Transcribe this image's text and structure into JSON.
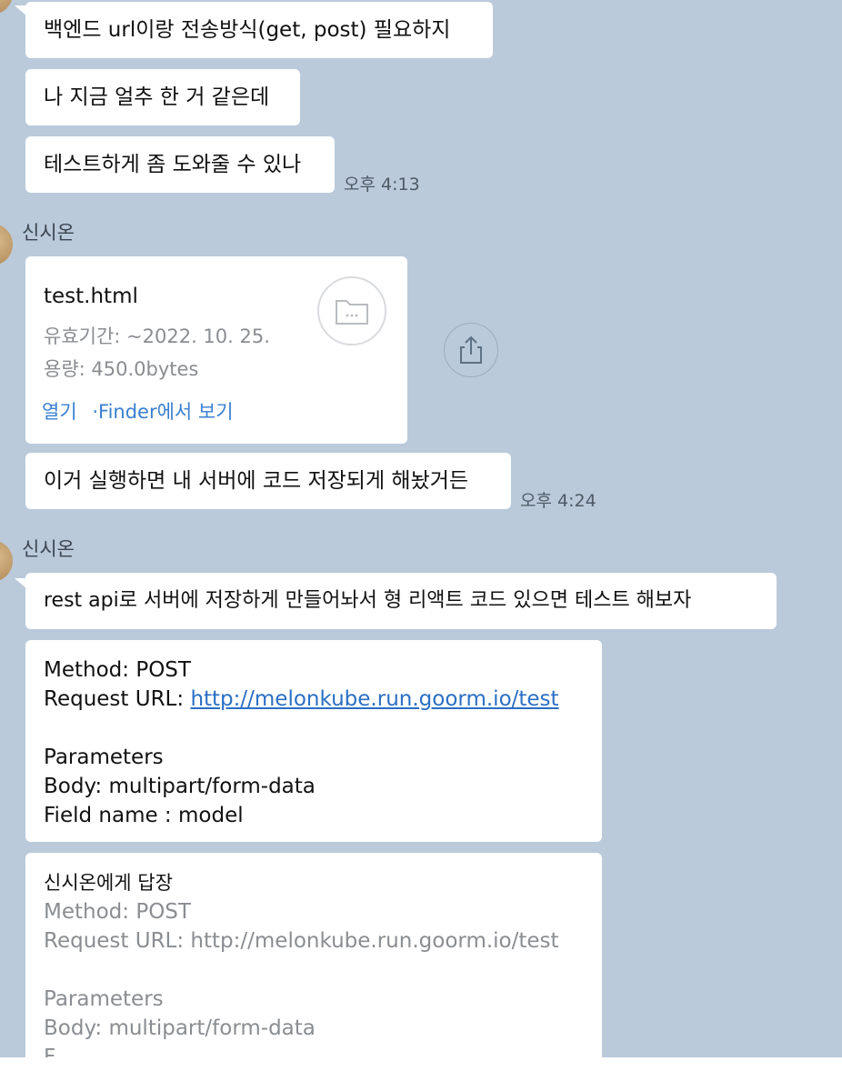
{
  "messages": {
    "m1": "백엔드 url이랑 전송방식(get, post) 필요하지",
    "m2": "나 지금 얼추 한 거 같은데",
    "m3": "테스트하게 좀 도와줄 수 있나",
    "m3_time": "오후 4:13",
    "sender1": "신시온",
    "file": {
      "name": "test.html",
      "expiry": "유효기간: ~2022. 10. 25.",
      "size": "용량: 450.0bytes",
      "open": "열기",
      "separator": "·",
      "finder": "Finder에서 보기"
    },
    "m4": "이거 실행하면 내 서버에 코드 저장되게 해놨거든",
    "m4_time": "오후 4:24",
    "sender2": "신시온",
    "m5": "rest api로 서버에 저장하게 만들어놔서 형 리액트 코드 있으면 테스트 해보자",
    "api": {
      "method": "Method: POST",
      "url_label": "Request URL: ",
      "url": "http://melonkube.run.goorm.io/test",
      "params": "Parameters",
      "body": "Body: multipart/form-data",
      "field": "Field name : model"
    },
    "reply": {
      "header": "신시온에게 답장",
      "method": "Method: POST",
      "url": "Request URL: http://melonkube.run.goorm.io/test",
      "params": "Parameters",
      "body": "Body: multipart/form-data",
      "cut": "F"
    }
  },
  "icons": {
    "folder": "folder-icon",
    "share": "share-icon",
    "avatar": "avatar"
  },
  "colors": {
    "background": "#bacadb",
    "bubble": "#ffffff",
    "link": "#2a6fc4",
    "meta": "#8a8d91"
  }
}
